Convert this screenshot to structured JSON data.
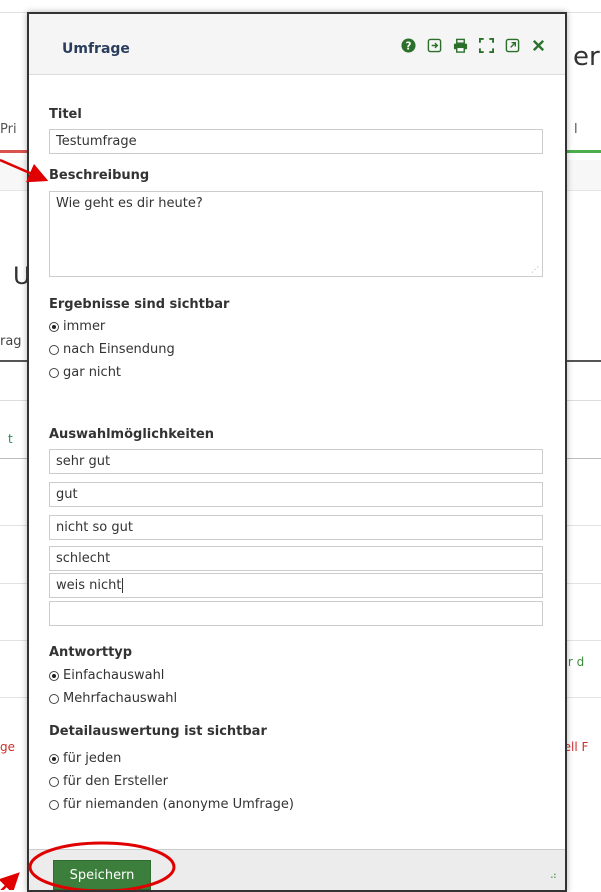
{
  "background": {
    "heading_fragment": "err",
    "tab_left_fragment": "Pri",
    "tab_right_fragment": "l",
    "big_letter": "U",
    "row_fragment": "rag",
    "green_fragment": "t",
    "right_link_fragment": "für d",
    "left_red_fragment": "ge",
    "right_red_fragment": "nell F"
  },
  "dialog": {
    "title": "Umfrage",
    "tools": {
      "help": "help-icon",
      "export": "export-icon",
      "print": "print-icon",
      "fullscreen": "fullscreen-icon",
      "popout": "popout-icon",
      "close": "close-icon"
    },
    "fields": {
      "title_label": "Titel",
      "title_value": "Testumfrage",
      "description_label": "Beschreibung",
      "description_value": "Wie geht es dir heute?",
      "results_label": "Ergebnisse sind sichtbar",
      "results_options": [
        "immer",
        "nach Einsendung",
        "gar nicht"
      ],
      "results_selected": 0,
      "choices_label": "Auswahlmöglichkeiten",
      "choices": [
        "sehr gut",
        "gut",
        "nicht so gut",
        "schlecht",
        "weis nicht",
        ""
      ],
      "answer_type_label": "Antworttyp",
      "answer_type_options": [
        "Einfachauswahl",
        "Mehrfachauswahl"
      ],
      "answer_type_selected": 0,
      "detail_label": "Detailauswertung ist sichtbar",
      "detail_options": [
        "für jeden",
        "für den Ersteller",
        "für niemanden (anonyme Umfrage)"
      ],
      "detail_selected": 0
    },
    "save_label": "Speichern"
  },
  "colors": {
    "accent_green": "#3c7f3c",
    "annotation_red": "#e00000"
  }
}
